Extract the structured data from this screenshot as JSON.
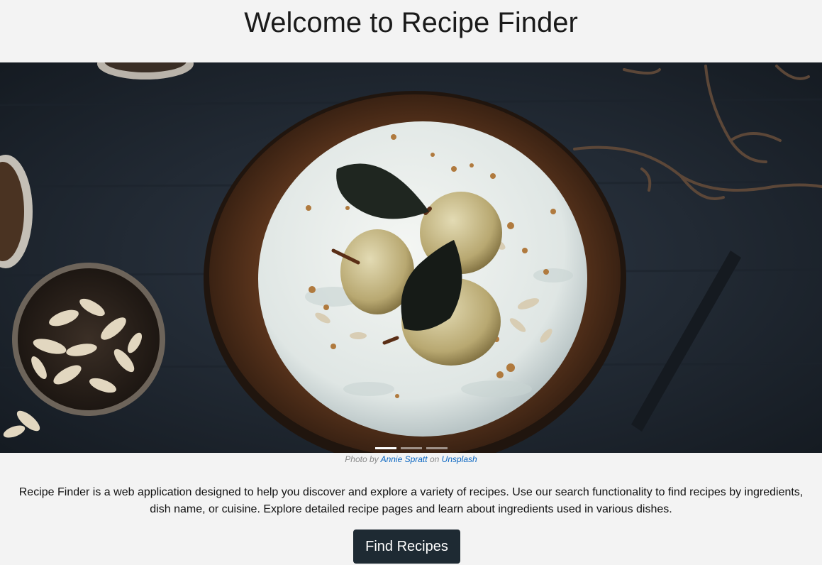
{
  "header": {
    "title": "Welcome to Recipe Finder"
  },
  "hero": {
    "image_alt": "Poached pear cake on a wooden board",
    "slides_count_visible": 3,
    "active_slide": 1
  },
  "credit": {
    "prefix": "Photo by",
    "author": "Annie Spratt",
    "middle": "on",
    "source": "Unsplash"
  },
  "intro": {
    "text": "Recipe Finder is a web application designed to help you discover and explore a variety of recipes. Use our search functionality to find recipes by ingredients, dish name, or cuisine. Explore detailed recipe pages and learn about ingredients used in various dishes."
  },
  "cta": {
    "label": "Find Recipes"
  },
  "colors": {
    "background": "#f3f3f3",
    "button": "#1e2a33",
    "link": "#0a66c2"
  }
}
